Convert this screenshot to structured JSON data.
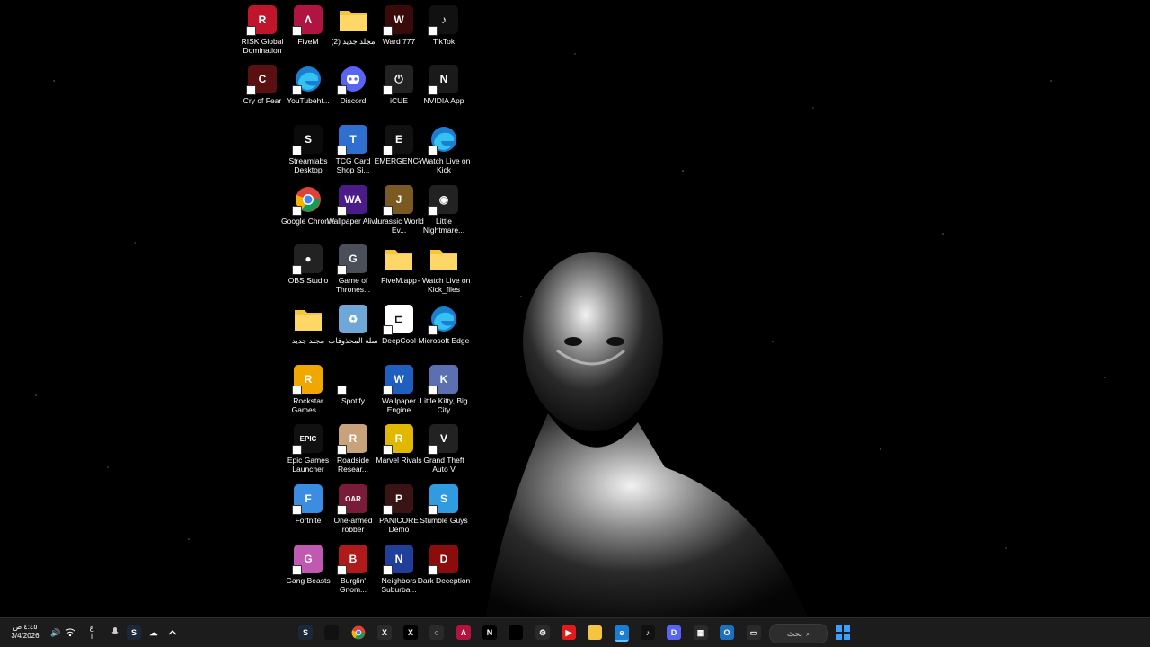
{
  "desktop": {
    "icons": [
      {
        "label": "RISK Global Domination",
        "glyph": "R",
        "color": "#c0152b",
        "icon": "risk-icon"
      },
      {
        "label": "FiveM",
        "glyph": "Λ",
        "color": "#b01440",
        "icon": "fivem-icon"
      },
      {
        "label": "مجلد جديد (2)",
        "glyph": "",
        "color": "#f5c542",
        "icon": "folder-icon"
      },
      {
        "label": "Ward 777",
        "glyph": "W",
        "color": "#3a0a0a",
        "icon": "ward-icon"
      },
      {
        "label": "TikTok",
        "glyph": "♪",
        "color": "#111111",
        "icon": "tiktok-icon"
      },
      {
        "label": "Cry of Fear",
        "glyph": "C",
        "color": "#5a1010",
        "icon": "cry-of-fear-icon"
      },
      {
        "label": "YouTubeht...",
        "glyph": "e",
        "color": "#1b7fd1",
        "icon": "edge-icon"
      },
      {
        "label": "Discord",
        "glyph": "D",
        "color": "#5865f2",
        "icon": "discord-icon"
      },
      {
        "label": "iCUE",
        "glyph": "⏻",
        "color": "#222222",
        "icon": "icue-icon"
      },
      {
        "label": "NVIDIA App",
        "glyph": "N",
        "color": "#1a1a1a",
        "icon": "nvidia-icon"
      },
      {
        "label": "Streamlabs Desktop",
        "glyph": "S",
        "color": "#0b0b0b",
        "icon": "streamlabs-icon"
      },
      {
        "label": "TCG Card Shop Si...",
        "glyph": "T",
        "color": "#2f6fd0",
        "icon": "tcg-icon"
      },
      {
        "label": "EMERGENCY",
        "glyph": "E",
        "color": "#111111",
        "icon": "emergency-icon"
      },
      {
        "label": "- Watch Live on Kick",
        "glyph": "e",
        "color": "#1b7fd1",
        "icon": "edge-icon"
      },
      {
        "label": "Google Chrome",
        "glyph": "",
        "color": "#ffffff",
        "icon": "chrome-icon"
      },
      {
        "label": "Wallpaper Alive",
        "glyph": "WA",
        "color": "#4b1b8a",
        "icon": "wallpaper-alive-icon"
      },
      {
        "label": "Jurassic World Ev...",
        "glyph": "J",
        "color": "#7a5a20",
        "icon": "jurassic-icon"
      },
      {
        "label": "Little Nightmare...",
        "glyph": "◉",
        "color": "#222222",
        "icon": "little-nightmares-icon"
      },
      {
        "label": "OBS Studio",
        "glyph": "●",
        "color": "#222222",
        "icon": "obs-icon"
      },
      {
        "label": "Game of Thrones...",
        "glyph": "G",
        "color": "#4a4f5a",
        "icon": "got-icon"
      },
      {
        "label": "FiveM.app",
        "glyph": "",
        "color": "#f5c542",
        "icon": "folder-icon"
      },
      {
        "label": "- Watch Live on Kick_files",
        "glyph": "",
        "color": "#f5c542",
        "icon": "folder-icon"
      },
      {
        "label": "مجلد جديد",
        "glyph": "",
        "color": "#f5c542",
        "icon": "folder-icon"
      },
      {
        "label": "سلة المحذوفات",
        "glyph": "♻",
        "color": "#6fa8d8",
        "icon": "recycle-bin-icon"
      },
      {
        "label": "DeepCool",
        "glyph": "⊏",
        "color": "#ffffff",
        "icon": "deepcool-icon"
      },
      {
        "label": "Microsoft Edge",
        "glyph": "e",
        "color": "#1b7fd1",
        "icon": "edge-icon"
      },
      {
        "label": "Rockstar Games ...",
        "glyph": "R",
        "color": "#f0a800",
        "icon": "rockstar-icon"
      },
      {
        "label": "Spotify",
        "glyph": "",
        "color": "#000000",
        "icon": "spotify-icon"
      },
      {
        "label": "Wallpaper Engine",
        "glyph": "W",
        "color": "#1f5fc0",
        "icon": "wallpaper-engine-icon"
      },
      {
        "label": "Little Kitty, Big City",
        "glyph": "K",
        "color": "#5a70b0",
        "icon": "little-kitty-icon"
      },
      {
        "label": "Epic Games Launcher",
        "glyph": "EPIC",
        "color": "#111111",
        "icon": "epic-icon"
      },
      {
        "label": "Roadside Resear...",
        "glyph": "R",
        "color": "#c7a27a",
        "icon": "roadside-icon"
      },
      {
        "label": "Marvel Rivals",
        "glyph": "R",
        "color": "#e0b800",
        "icon": "marvel-rivals-icon"
      },
      {
        "label": "Grand Theft Auto V",
        "glyph": "V",
        "color": "#222222",
        "icon": "gta-icon"
      },
      {
        "label": "Fortnite",
        "glyph": "F",
        "color": "#3a8de0",
        "icon": "fortnite-icon"
      },
      {
        "label": "One-armed robber",
        "glyph": "OAR",
        "color": "#7a1b3a",
        "icon": "one-armed-robber-icon"
      },
      {
        "label": "PANICORE Demo",
        "glyph": "P",
        "color": "#3a1414",
        "icon": "panicore-icon"
      },
      {
        "label": "Stumble Guys",
        "glyph": "S",
        "color": "#2f9be0",
        "icon": "stumble-guys-icon"
      },
      {
        "label": "Gang Beasts",
        "glyph": "G",
        "color": "#c05ab0",
        "icon": "gang-beasts-icon"
      },
      {
        "label": "Burglin' Gnom...",
        "glyph": "B",
        "color": "#b01a1a",
        "icon": "burglin-icon"
      },
      {
        "label": "Neighbors Suburba...",
        "glyph": "N",
        "color": "#1f3f9a",
        "icon": "neighbors-icon"
      },
      {
        "label": "Dark Deception",
        "glyph": "D",
        "color": "#8a0c0c",
        "icon": "dark-deception-icon"
      }
    ]
  },
  "taskbar": {
    "search_label": "بحث",
    "clock_time": "٤:٤٥ ص",
    "clock_date": "3/4/2026",
    "lang": "ع",
    "lang_sub": "ا",
    "apps": [
      {
        "icon": "steam-icon",
        "glyph": "S",
        "color": "#1b2838"
      },
      {
        "icon": "circle-app-icon",
        "glyph": "",
        "color": "#111111"
      },
      {
        "icon": "chrome-icon",
        "glyph": "",
        "color": "#ffffff"
      },
      {
        "icon": "xbox-icon",
        "glyph": "X",
        "color": "#2a2a2a"
      },
      {
        "icon": "x-twitter-icon",
        "glyph": "X",
        "color": "#000000"
      },
      {
        "icon": "app-icon",
        "glyph": "○",
        "color": "#2a2a2a"
      },
      {
        "icon": "fivem-icon",
        "glyph": "Λ",
        "color": "#b01440"
      },
      {
        "icon": "netflix-icon",
        "glyph": "N",
        "color": "#000000"
      },
      {
        "icon": "terminal-icon",
        "glyph": "",
        "color": "#000000"
      },
      {
        "icon": "settings-icon",
        "glyph": "⚙",
        "color": "#2a2a2a"
      },
      {
        "icon": "youtube-icon",
        "glyph": "▶",
        "color": "#e01b1b"
      },
      {
        "icon": "file-explorer-icon",
        "glyph": "",
        "color": "#f5c542"
      },
      {
        "icon": "edge-icon",
        "glyph": "e",
        "color": "#1b7fd1"
      },
      {
        "icon": "tiktok-icon",
        "glyph": "♪",
        "color": "#111111"
      },
      {
        "icon": "discord-icon",
        "glyph": "D",
        "color": "#5865f2"
      },
      {
        "icon": "store-icon",
        "glyph": "▦",
        "color": "#2a2a2a"
      },
      {
        "icon": "outlook-icon",
        "glyph": "O",
        "color": "#1f6fc0"
      },
      {
        "icon": "window-icon",
        "glyph": "▭",
        "color": "#2a2a2a"
      }
    ]
  }
}
